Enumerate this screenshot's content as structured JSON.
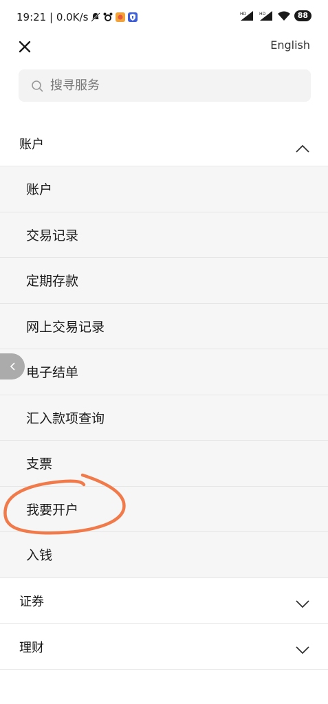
{
  "status_bar": {
    "time_speed": "19:21 | 0.0K/s",
    "battery": "88"
  },
  "header": {
    "close_icon": "close-icon",
    "language_link": "English"
  },
  "search": {
    "placeholder": "搜寻服务"
  },
  "menu": {
    "sections": [
      {
        "label": "账户",
        "expanded": true,
        "items": [
          "账户",
          "交易记录",
          "定期存款",
          "网上交易记录",
          "电子结单",
          "汇入款项查询",
          "支票",
          "我要开户",
          "入钱"
        ]
      },
      {
        "label": "证券",
        "expanded": false
      },
      {
        "label": "理财",
        "expanded": false
      }
    ]
  },
  "colors": {
    "annotation": "#f07a4a",
    "submenu_bg": "#f6f6f6",
    "search_bg": "#f3f3f3"
  }
}
